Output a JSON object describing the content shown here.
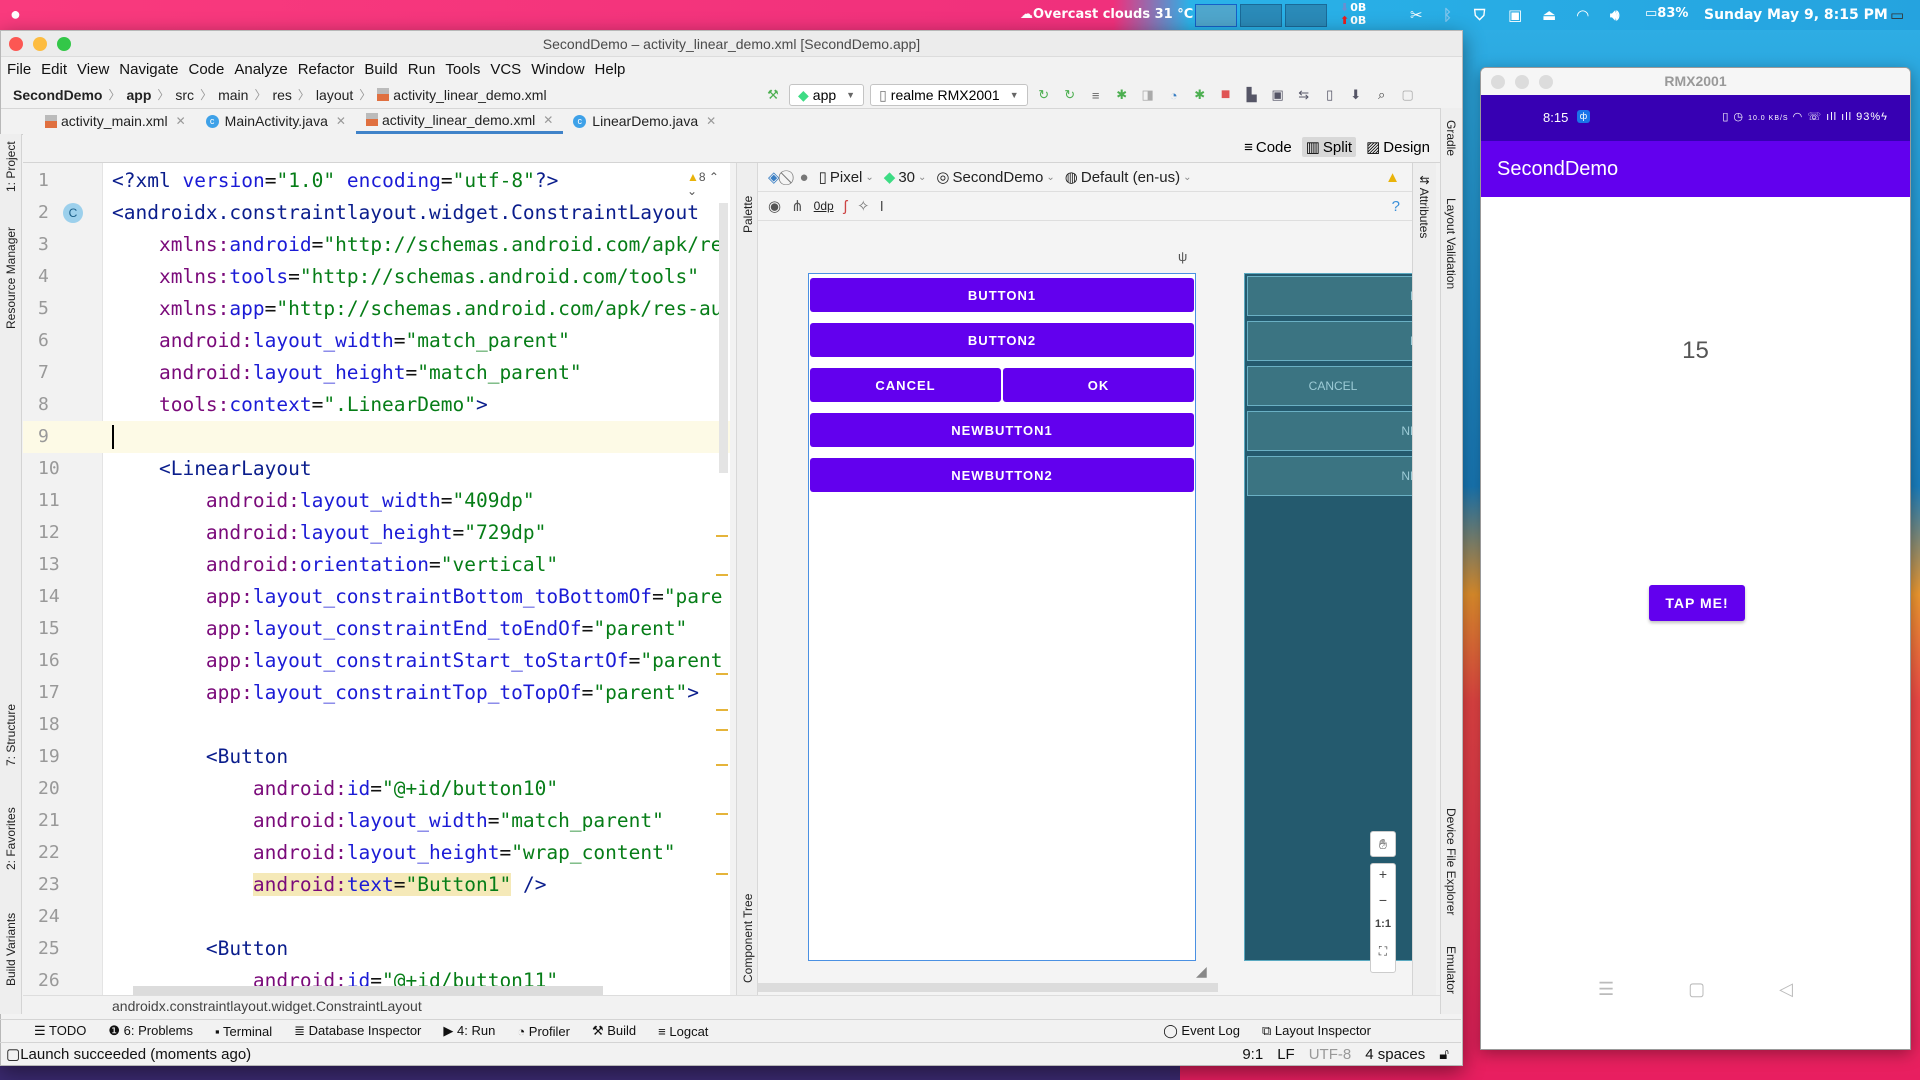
{
  "system_bar": {
    "apple": "",
    "weather": "☁Overcast clouds 31 °C",
    "net_down": "0B",
    "net_up": "0B",
    "battery": "83%",
    "datetime": "Sunday May  9,  8:15 PM"
  },
  "ide": {
    "window_title": "SecondDemo – activity_linear_demo.xml [SecondDemo.app]",
    "menu": [
      "File",
      "Edit",
      "View",
      "Navigate",
      "Code",
      "Analyze",
      "Refactor",
      "Build",
      "Run",
      "Tools",
      "VCS",
      "Window",
      "Help"
    ],
    "breadcrumb": [
      "SecondDemo",
      "app",
      "src",
      "main",
      "res",
      "layout",
      "activity_linear_demo.xml"
    ],
    "run_config": "app",
    "device": "realme RMX2001",
    "tabs": [
      {
        "label": "activity_main.xml",
        "type": "xml",
        "active": false
      },
      {
        "label": "MainActivity.java",
        "type": "java",
        "active": false
      },
      {
        "label": "activity_linear_demo.xml",
        "type": "xml",
        "active": true
      },
      {
        "label": "LinearDemo.java",
        "type": "java",
        "active": false
      }
    ],
    "view_modes": {
      "code": "Code",
      "split": "Split",
      "design": "Design",
      "selected": "Split"
    },
    "left_tools": [
      "1: Project",
      "Resource Manager",
      "7: Structure",
      "2: Favorites",
      "Build Variants"
    ],
    "right_tools": [
      "Gradle",
      "Layout Validation",
      "Device File Explorer",
      "Emulator"
    ],
    "attributes_tab": "Attributes",
    "palette_tab": "Palette",
    "component_tree_tab": "Component Tree",
    "warnings_count": "8",
    "code_lines": [
      {
        "n": "1",
        "text": "<?xml version=\"1.0\" encoding=\"utf-8\"?>"
      },
      {
        "n": "2",
        "text": "<androidx.constraintlayout.widget.ConstraintLayout"
      },
      {
        "n": "3",
        "text": "    xmlns:android=\"http://schemas.android.com/apk/re"
      },
      {
        "n": "4",
        "text": "    xmlns:tools=\"http://schemas.android.com/tools\""
      },
      {
        "n": "5",
        "text": "    xmlns:app=\"http://schemas.android.com/apk/res-au"
      },
      {
        "n": "6",
        "text": "    android:layout_width=\"match_parent\""
      },
      {
        "n": "7",
        "text": "    android:layout_height=\"match_parent\""
      },
      {
        "n": "8",
        "text": "    tools:context=\".LinearDemo\">"
      },
      {
        "n": "9",
        "text": ""
      },
      {
        "n": "10",
        "text": "    <LinearLayout"
      },
      {
        "n": "11",
        "text": "        android:layout_width=\"409dp\""
      },
      {
        "n": "12",
        "text": "        android:layout_height=\"729dp\""
      },
      {
        "n": "13",
        "text": "        android:orientation=\"vertical\""
      },
      {
        "n": "14",
        "text": "        app:layout_constraintBottom_toBottomOf=\"pare"
      },
      {
        "n": "15",
        "text": "        app:layout_constraintEnd_toEndOf=\"parent\""
      },
      {
        "n": "16",
        "text": "        app:layout_constraintStart_toStartOf=\"parent"
      },
      {
        "n": "17",
        "text": "        app:layout_constraintTop_toTopOf=\"parent\">"
      },
      {
        "n": "18",
        "text": ""
      },
      {
        "n": "19",
        "text": "        <Button"
      },
      {
        "n": "20",
        "text": "            android:id=\"@+id/button10\""
      },
      {
        "n": "21",
        "text": "            android:layout_width=\"match_parent\""
      },
      {
        "n": "22",
        "text": "            android:layout_height=\"wrap_content\""
      },
      {
        "n": "23",
        "text": "            android:text=\"Button1\" />"
      },
      {
        "n": "24",
        "text": ""
      },
      {
        "n": "25",
        "text": "        <Button"
      },
      {
        "n": "26",
        "text": "            android:id=\"@+id/button11\""
      }
    ],
    "current_line": 9,
    "design_toolbar": {
      "device": "Pixel",
      "api": "30",
      "theme": "SecondDemo",
      "locale": "Default (en-us)",
      "margin": "0dp"
    },
    "preview_buttons": [
      "BUTTON1",
      "BUTTON2",
      "CANCEL",
      "OK",
      "NEWBUTTON1",
      "NEWBUTTON2"
    ],
    "blueprint_labels": [
      "B",
      "B",
      "CANCEL",
      "NE",
      "NE"
    ],
    "zoom_controls": {
      "plus": "+",
      "minus": "−",
      "one": "1:1"
    },
    "path_bar": "androidx.constraintlayout.widget.ConstraintLayout",
    "tool_windows": [
      {
        "label": "TODO",
        "icon": "list-icon"
      },
      {
        "label": "6: Problems",
        "icon": "problems-icon"
      },
      {
        "label": "Terminal",
        "icon": "terminal-icon"
      },
      {
        "label": "Database Inspector",
        "icon": "database-icon"
      },
      {
        "label": "4: Run",
        "icon": "run-icon"
      },
      {
        "label": "Profiler",
        "icon": "profiler-icon"
      },
      {
        "label": "Build",
        "icon": "hammer-icon"
      },
      {
        "label": "Logcat",
        "icon": "logcat-icon"
      }
    ],
    "tool_windows_right": [
      {
        "label": "Event Log",
        "icon": "event-log-icon"
      },
      {
        "label": "Layout Inspector",
        "icon": "layout-inspector-icon"
      }
    ],
    "status": {
      "message": "Launch succeeded (moments ago)",
      "position": "9:1",
      "line_sep": "LF",
      "encoding": "UTF-8",
      "indent": "4 spaces"
    }
  },
  "emulator": {
    "window_title": "RMX2001",
    "phone_time": "8:15",
    "phone_battery": "93%",
    "phone_net_speed": "10.0 KB/S",
    "app_title": "SecondDemo",
    "counter": "15",
    "tap_button": "TAP ME!"
  },
  "colors": {
    "primary": "#6200ee",
    "primary_dark": "#3700b3",
    "blueprint": "#245a6e"
  }
}
